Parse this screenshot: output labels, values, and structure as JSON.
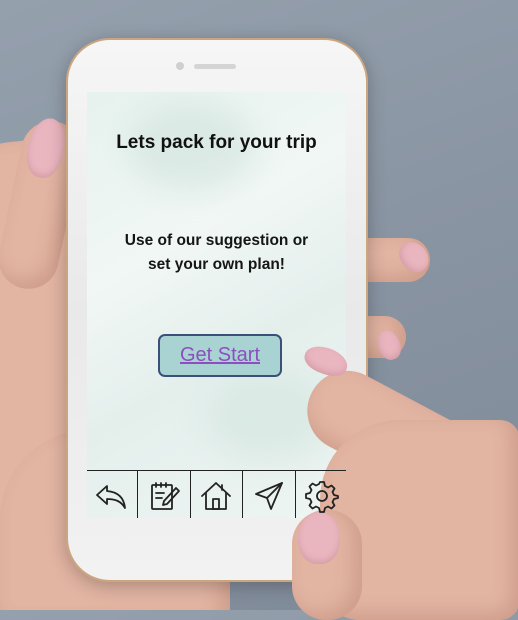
{
  "screen": {
    "title": "Lets pack for your trip",
    "subtitle_lines": [
      "Use of our suggestion or",
      "set your own plan!"
    ],
    "start_button_label": "Get Start"
  },
  "toolbar": {
    "items": [
      {
        "icon": "back-arrow-icon"
      },
      {
        "icon": "notepad-pencil-icon"
      },
      {
        "icon": "home-icon"
      },
      {
        "icon": "send-navigation-icon"
      },
      {
        "icon": "gear-icon"
      }
    ]
  },
  "colors": {
    "button_fill": "#a9d3d2",
    "button_border": "#3c4f78",
    "button_text": "#8b4fc0",
    "background": "#8a95a3"
  }
}
